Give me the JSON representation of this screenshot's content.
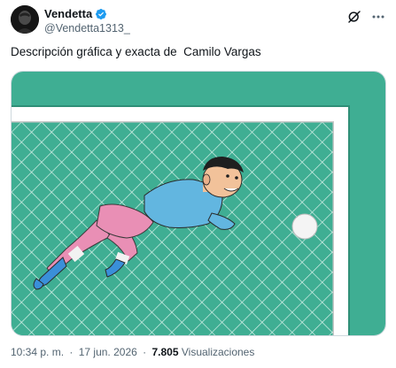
{
  "author": {
    "display_name": "Vendetta",
    "handle": "@Vendetta1313_",
    "verified": true,
    "avatar_icon": "avatar-image"
  },
  "tweet": {
    "text": "Descripción gráfica y exacta de  Camilo Vargas"
  },
  "meta": {
    "time": "10:34 p. m.",
    "separator": "·",
    "date": "17 jun. 2026",
    "views_count": "7.805",
    "views_label": "Visualizaciones"
  },
  "icons": {
    "grok": "grok-icon",
    "more": "more-icon",
    "verified": "verified-badge-icon"
  },
  "colors": {
    "verified_blue": "#1d9bf0",
    "pitch_green": "#3fae93",
    "text_primary": "#0f1419",
    "text_secondary": "#536471"
  }
}
